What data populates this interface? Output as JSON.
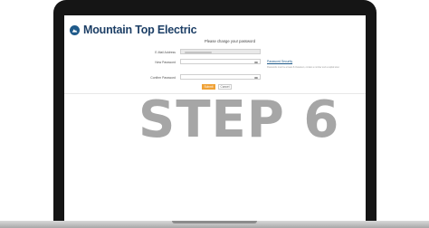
{
  "brand": {
    "name": "Mountain Top Electric",
    "logo_icon": "mountain-logo-icon",
    "color": "#1d3f66"
  },
  "form": {
    "heading": "Please change your password",
    "email_label": "E-Mail Address",
    "email_value": "",
    "new_password_label": "New Password",
    "confirm_password_label": "Confirm Password",
    "security_link": "Password Security",
    "security_hint": "Passwords must be at least 8 characters, contain a number and a capital letter."
  },
  "buttons": {
    "submit": "Submit",
    "cancel": "Cancel"
  },
  "overlay": {
    "text": "STEP 6"
  },
  "colors": {
    "accent": "#f0a237",
    "link": "#1f5a8a",
    "overlay": "#a6a6a6"
  }
}
